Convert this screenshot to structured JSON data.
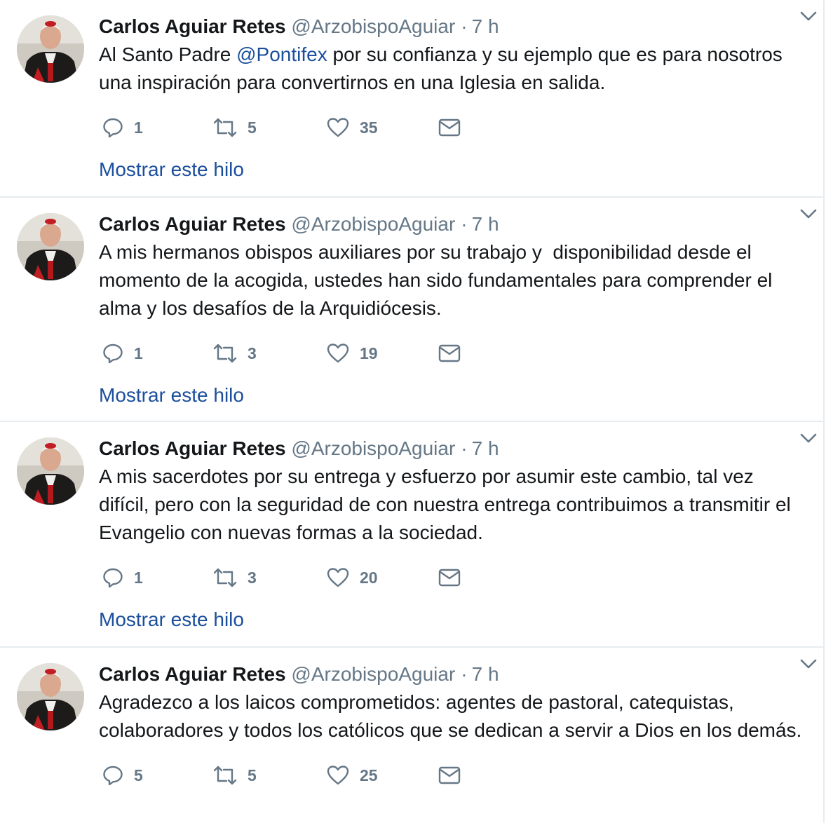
{
  "colors": {
    "link": "#1b4f9c",
    "muted": "#657786",
    "text": "#14171a",
    "divider": "#e6ecf0"
  },
  "tweets": [
    {
      "fullname": "Carlos Aguiar Retes",
      "handle": "@ArzobispoAguiar",
      "dot": "·",
      "time": "7 h",
      "text_before": "Al Santo Padre ",
      "mention": "@Pontifex",
      "text_after": " por su confianza y su ejemplo que es para nosotros una inspiración para convertirnos en una Iglesia en salida.",
      "replies": "1",
      "retweets": "5",
      "likes": "35",
      "thread_link": "Mostrar este hilo"
    },
    {
      "fullname": "Carlos Aguiar Retes",
      "handle": "@ArzobispoAguiar",
      "dot": "·",
      "time": "7 h",
      "text": "A mis hermanos obispos auxiliares por su trabajo y  disponibilidad desde el momento de la acogida, ustedes han sido fundamentales para comprender el alma y los desafíos de la Arquidiócesis.",
      "replies": "1",
      "retweets": "3",
      "likes": "19",
      "thread_link": "Mostrar este hilo"
    },
    {
      "fullname": "Carlos Aguiar Retes",
      "handle": "@ArzobispoAguiar",
      "dot": "·",
      "time": "7 h",
      "text": "A mis sacerdotes por su entrega y esfuerzo por asumir este cambio, tal vez difícil, pero con la seguridad de con nuestra entrega contribuimos a transmitir el Evangelio con nuevas formas a la sociedad.",
      "replies": "1",
      "retweets": "3",
      "likes": "20",
      "thread_link": "Mostrar este hilo"
    },
    {
      "fullname": "Carlos Aguiar Retes",
      "handle": "@ArzobispoAguiar",
      "dot": "·",
      "time": "7 h",
      "text": "Agradezco a los laicos comprometidos: agentes de pastoral, catequistas, colaboradores y todos los católicos que se dedican a servir a Dios en los demás.",
      "replies": "5",
      "retweets": "5",
      "likes": "25"
    }
  ],
  "icons": {
    "reply": "reply-icon",
    "retweet": "retweet-icon",
    "like": "heart-icon",
    "dm": "envelope-icon",
    "more": "chevron-down-icon"
  }
}
